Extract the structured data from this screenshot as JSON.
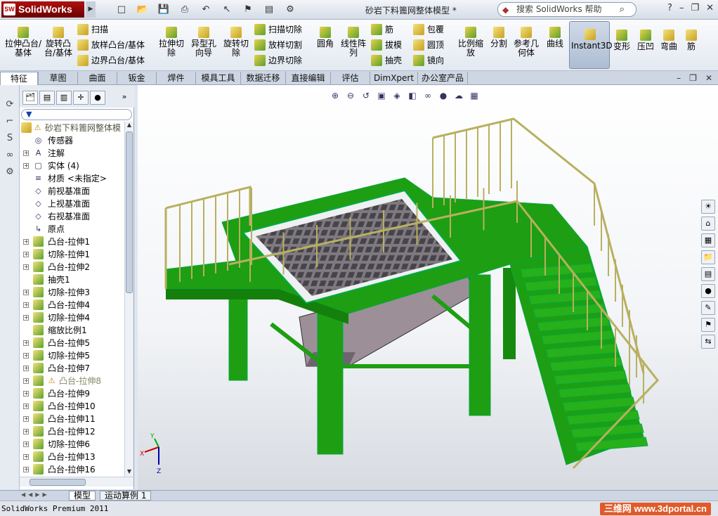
{
  "app": {
    "brand": "SolidWorks",
    "brand_mark": "SW",
    "document_title": "砂岩下料篦网整体模型 *"
  },
  "search": {
    "placeholder": "搜索 SolidWorks 帮助"
  },
  "window_controls": {
    "help": "?",
    "minimize": "–",
    "restore": "❐",
    "close": "✕"
  },
  "ribbon": {
    "large": [
      "拉伸凸台/基体",
      "旋转凸台/基体",
      "拉伸切除",
      "异型孔向导",
      "旋转切除",
      "圆角",
      "线性阵列",
      "比例缩放",
      "分割",
      "参考几何体",
      "曲线",
      "Instant3D",
      "变形",
      "压凹",
      "弯曲",
      "筋"
    ],
    "small_col1": [
      "扫描",
      "放样凸台/基体",
      "边界凸台/基体"
    ],
    "small_col2": [
      "扫描切除",
      "放样切割",
      "边界切除"
    ],
    "small_col3": [
      "筋",
      "拔模",
      "抽壳"
    ],
    "small_col4": [
      "包覆",
      "圆顶",
      "镜向"
    ]
  },
  "tabs": [
    "特征",
    "草图",
    "曲面",
    "钣金",
    "焊件",
    "模具工具",
    "数据迁移",
    "直接编辑",
    "评估",
    "DimXpert",
    "办公室产品"
  ],
  "tree": {
    "tabs": [
      "特征管理",
      "属性",
      "配置",
      "DimXpert",
      "外观"
    ],
    "root": "砂岩下料篦网整体模",
    "items": [
      "传感器",
      "注解",
      "实体 (4)",
      "材质 <未指定>",
      "前视基准面",
      "上视基准面",
      "右视基准面",
      "原点",
      "凸台-拉伸1",
      "切除-拉伸1",
      "凸台-拉伸2",
      "抽壳1",
      "切除-拉伸3",
      "凸台-拉伸4",
      "切除-拉伸4",
      "缩放比例1",
      "凸台-拉伸5",
      "切除-拉伸5",
      "凸台-拉伸7",
      "凸台-拉伸8",
      "凸台-拉伸9",
      "凸台-拉伸10",
      "凸台-拉伸11",
      "凸台-拉伸12",
      "切除-拉伸6",
      "凸台-拉伸13",
      "凸台-拉伸16"
    ]
  },
  "triad": {
    "x": "X",
    "y": "Y",
    "z": "Z"
  },
  "bottom_tabs": [
    "模型",
    "运动算例 1"
  ],
  "status": {
    "text": "SolidWorks Premium 2011",
    "watermark": "三维网 www.3dportal.cn"
  },
  "colors": {
    "steel_green": "#1e9e12",
    "handrail": "#b8b060",
    "hopper": "#8c7f88",
    "accent_red": "#b01010"
  }
}
